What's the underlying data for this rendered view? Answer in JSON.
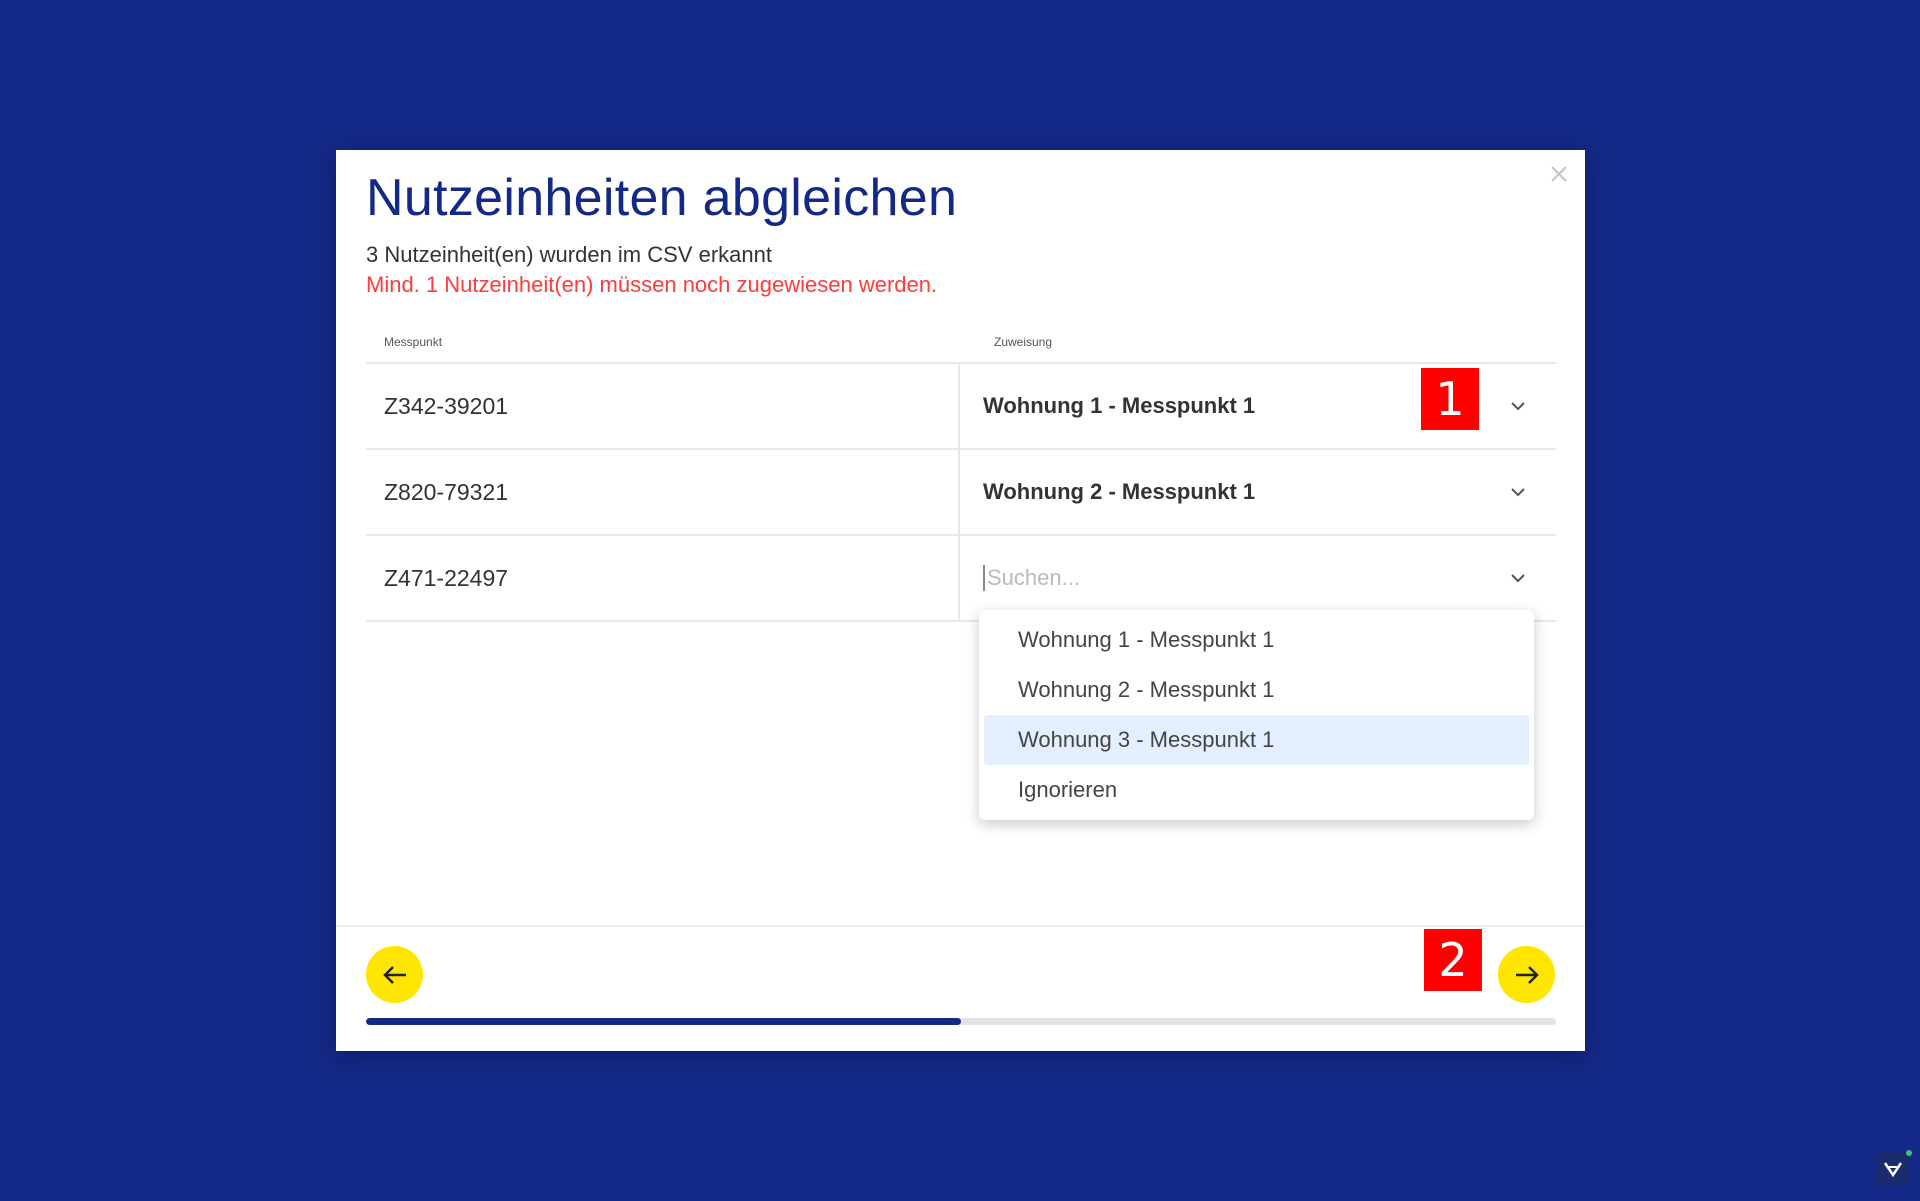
{
  "modal": {
    "title": "Nutzeinheiten abgleichen",
    "subtitle": "3 Nutzeinheit(en) wurden im CSV erkannt",
    "warning": "Mind. 1 Nutzeinheit(en) müssen noch zugewiesen werden."
  },
  "table": {
    "headers": {
      "messpunkt": "Messpunkt",
      "zuweisung": "Zuweisung"
    },
    "rows": [
      {
        "messpunkt": "Z342-39201",
        "zuweisung": "Wohnung 1 - Messpunkt 1"
      },
      {
        "messpunkt": "Z820-79321",
        "zuweisung": "Wohnung 2 - Messpunkt 1"
      },
      {
        "messpunkt": "Z471-22497",
        "zuweisung": ""
      }
    ],
    "search_placeholder": "Suchen..."
  },
  "dropdown": {
    "options": [
      "Wohnung 1 - Messpunkt 1",
      "Wohnung 2 - Messpunkt 1",
      "Wohnung 3 - Messpunkt 1",
      "Ignorieren"
    ],
    "highlighted_index": 2
  },
  "progress": {
    "fraction": 0.5
  },
  "markers": {
    "first": "1",
    "second": "2"
  },
  "icons": {
    "close": "close-icon",
    "chevron": "chevron-down-icon",
    "back": "arrow-left-icon",
    "next": "arrow-right-icon",
    "logo": "app-logo-icon"
  },
  "colors": {
    "background": "#142887",
    "accent": "#ffe600",
    "warning": "#ff3b3b",
    "highlight": "#e3efff",
    "marker": "#ff0000"
  }
}
